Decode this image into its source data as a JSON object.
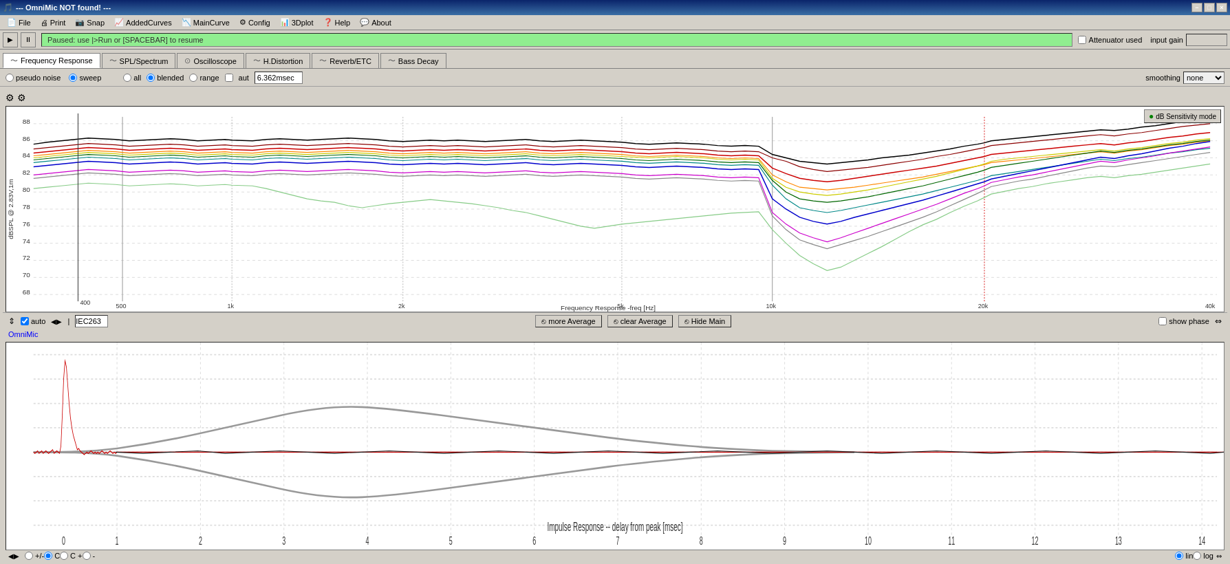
{
  "titleBar": {
    "text": "--- OmniMic NOT found! ---",
    "minBtn": "−",
    "maxBtn": "□",
    "closeBtn": "×"
  },
  "menuBar": {
    "items": [
      {
        "label": "File",
        "icon": "📄"
      },
      {
        "label": "Print",
        "icon": "🖨"
      },
      {
        "label": "Snap",
        "icon": "📷"
      },
      {
        "label": "AddedCurves",
        "icon": "📈"
      },
      {
        "label": "MainCurve",
        "icon": "📉"
      },
      {
        "label": "Config",
        "icon": "⚙"
      },
      {
        "label": "3Dplot",
        "icon": "🗱"
      },
      {
        "label": "Help",
        "icon": "❓"
      },
      {
        "label": "About",
        "icon": "💬"
      }
    ]
  },
  "toolbar": {
    "statusText": "Paused: use |>Run or [SPACEBAR] to resume",
    "attenuatorLabel": "Attenuator used",
    "inputGainLabel": "input gain"
  },
  "tabs": [
    {
      "label": "Frequency Response",
      "icon": "~",
      "active": true
    },
    {
      "label": "SPL/Spectrum",
      "icon": "~"
    },
    {
      "label": "Oscilloscope",
      "icon": "⊙"
    },
    {
      "label": "H.Distortion",
      "icon": "~"
    },
    {
      "label": "Reverb/ETC",
      "icon": "~"
    },
    {
      "label": "Bass Decay",
      "icon": "~"
    }
  ],
  "optionsBar": {
    "radioGroup1": [
      {
        "label": "pseudo noise",
        "value": "pseudo",
        "checked": false
      },
      {
        "label": "sweep",
        "value": "sweep",
        "checked": true
      }
    ],
    "radioGroup2": [
      {
        "label": "all",
        "value": "all",
        "checked": false
      },
      {
        "label": "blended",
        "value": "blended",
        "checked": true
      },
      {
        "label": "range",
        "value": "range",
        "checked": false
      }
    ],
    "autLabel": "aut",
    "timeValue": "6.362msec",
    "smoothingLabel": "smoothing",
    "smoothingValue": "none"
  },
  "chart": {
    "dbSensitivityBtn": "dB Sensitivity mode",
    "yAxisLabel": "dBSPL @ 2.83V,1m",
    "yAxisValues": [
      "88",
      "86",
      "84",
      "82",
      "80",
      "78",
      "76",
      "74",
      "72",
      "70",
      "68"
    ],
    "xAxisLabels": [
      "400",
      "500",
      "1k",
      "2k",
      "5k",
      "10k",
      "20k",
      "40k"
    ],
    "freqResponseLabel": "Frequency Response -freq [Hz]",
    "showPhaseLabel": "show phase"
  },
  "chartControls": {
    "autoLabel": "auto",
    "freqValue": "IEC263",
    "moreAverageBtn": "more Average",
    "clearAverageBtn": "clear Average",
    "hideMainBtn": "Hide Main",
    "omniMicLabel": "OmniMic"
  },
  "impulseChart": {
    "xAxisLabel": "Impulse Response -- delay from peak [msec]",
    "xTickLabels": [
      "0",
      "1",
      "2",
      "3",
      "4",
      "5",
      "6",
      "7",
      "8",
      "9",
      "10",
      "11",
      "12",
      "13",
      "14"
    ],
    "linLabel": "lin",
    "logLabel": "log"
  }
}
